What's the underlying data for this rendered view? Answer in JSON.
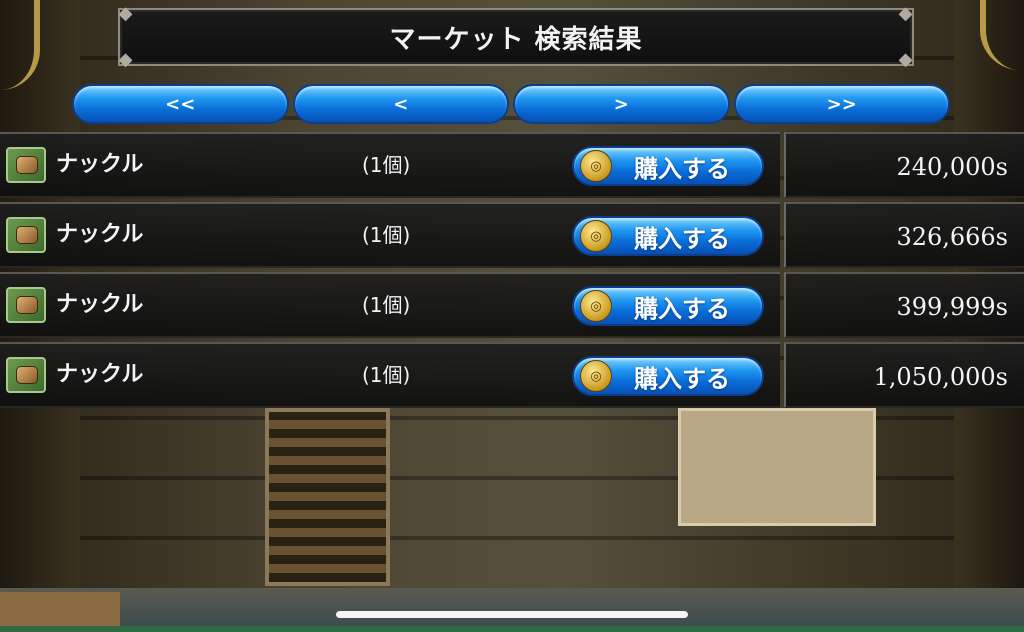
{
  "title": "マーケット 検索結果",
  "nav": {
    "first": "<<",
    "prev": "<",
    "next": ">",
    "last": ">>"
  },
  "listings": [
    {
      "name": "ナックル",
      "quantity": "(1個)",
      "buy_label": "購入する",
      "price": "240,000s"
    },
    {
      "name": "ナックル",
      "quantity": "(1個)",
      "buy_label": "購入する",
      "price": "326,666s"
    },
    {
      "name": "ナックル",
      "quantity": "(1個)",
      "buy_label": "購入する",
      "price": "399,999s"
    },
    {
      "name": "ナックル",
      "quantity": "(1個)",
      "buy_label": "購入する",
      "price": "1,050,000s"
    }
  ],
  "icons": {
    "item": "knuckle-weapon-icon",
    "buy": "gold-coin-icon"
  },
  "colors": {
    "button_blue": "#1e96f0",
    "panel_dark": "#141414",
    "text": "#f4f4f4"
  }
}
